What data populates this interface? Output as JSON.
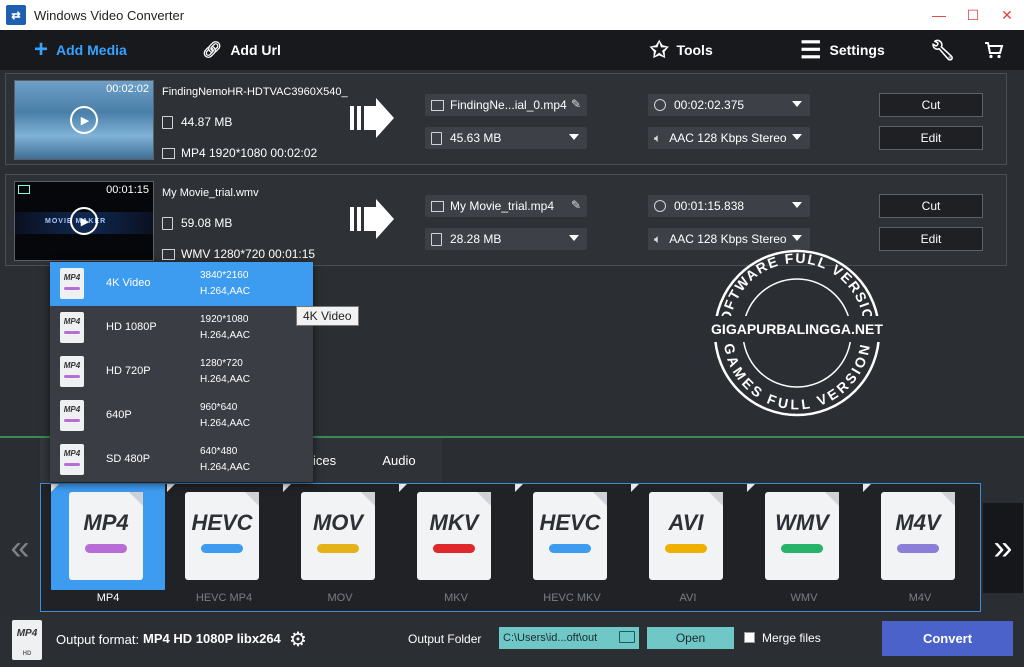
{
  "window": {
    "title": "Windows Video Converter",
    "minimize": "—",
    "maximize": "☐",
    "close": "✕"
  },
  "toolbar": {
    "add_media": "Add Media",
    "add_url": "Add Url",
    "tools": "Tools",
    "settings": "Settings"
  },
  "media": [
    {
      "duration": "00:02:02",
      "name": "FindingNemoHR-HDTVAC3960X540_",
      "size": "44.87 MB",
      "info": "MP4 1920*1080 00:02:02",
      "out_name": "FindingNe...ial_0.mp4",
      "out_size": "45.63 MB",
      "out_duration": "00:02:02.375",
      "audio": "AAC 128 Kbps Stereo",
      "cut": "Cut",
      "edit": "Edit"
    },
    {
      "duration": "00:01:15",
      "name": "My Movie_trial.wmv",
      "size": "59.08 MB",
      "info": "WMV 1280*720 00:01:15",
      "out_name": "My Movie_trial.mp4",
      "out_size": "28.28 MB",
      "out_duration": "00:01:15.838",
      "audio": "AAC 128 Kbps Stereo",
      "cut": "Cut",
      "edit": "Edit",
      "thumb_logo": "MOVIE MAKER"
    }
  ],
  "presets": [
    {
      "icon": "MP4",
      "name": "4K Video",
      "res": "3840*2160",
      "codec": "H.264,AAC",
      "selected": true
    },
    {
      "icon": "MP4",
      "name": "HD 1080P",
      "res": "1920*1080",
      "codec": "H.264,AAC"
    },
    {
      "icon": "MP4",
      "name": "HD 720P",
      "res": "1280*720",
      "codec": "H.264,AAC"
    },
    {
      "icon": "MP4",
      "name": "640P",
      "res": "960*640",
      "codec": "H.264,AAC"
    },
    {
      "icon": "MP4",
      "name": "SD 480P",
      "res": "640*480",
      "codec": "H.264,AAC"
    }
  ],
  "tooltip": "4K Video",
  "watermark": {
    "top_arc": "SOFTWARE FULL VERSION",
    "center": "GIGAPURBALINGGA.NET",
    "bottom_arc": "GAMES FULL VERSION"
  },
  "tabs": [
    "Devices",
    "Audio"
  ],
  "formats": [
    {
      "label": "MP4",
      "text": "MP4",
      "color": "#b86cd8",
      "selected": true
    },
    {
      "label": "HEVC MP4",
      "text": "HEVC",
      "color": "#3e9cf0"
    },
    {
      "label": "MOV",
      "text": "MOV",
      "color": "#e6b21a"
    },
    {
      "label": "MKV",
      "text": "MKV",
      "color": "#e0282c"
    },
    {
      "label": "HEVC MKV",
      "text": "HEVC",
      "color": "#3e9cf0"
    },
    {
      "label": "AVI",
      "text": "AVI",
      "color": "#f0b000"
    },
    {
      "label": "WMV",
      "text": "WMV",
      "color": "#27b36a"
    },
    {
      "label": "M4V",
      "text": "M4V",
      "color": "#8a7ed8"
    }
  ],
  "nav": {
    "prev": "«",
    "next": "»"
  },
  "bottom": {
    "format_icon": "MP4",
    "format_icon_sub": "HD",
    "output_label": "Output format:",
    "output_value": "MP4 HD 1080P libx264",
    "folder_label": "Output Folder",
    "folder_path": "C:\\Users\\id...oft\\out",
    "open": "Open",
    "merge": "Merge files",
    "convert": "Convert"
  },
  "colors": {
    "accent": "#3e9cf0",
    "convert": "#4a62c9",
    "teal": "#6fc7c6",
    "add_media": "#35a3ff"
  }
}
